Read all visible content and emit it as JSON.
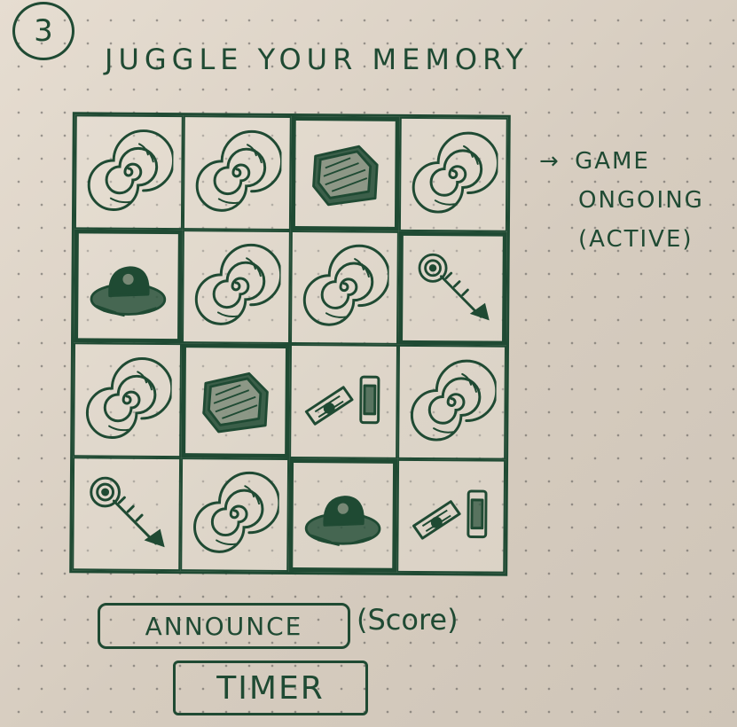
{
  "step_number": "3",
  "title": "JUGGLE YOUR MEMORY",
  "board": {
    "rows": 4,
    "columns": 4,
    "cells": [
      {
        "icon": "spiral-icon",
        "selected": false
      },
      {
        "icon": "spiral-icon",
        "selected": false
      },
      {
        "icon": "gem-icon",
        "selected": true
      },
      {
        "icon": "spiral-icon",
        "selected": false
      },
      {
        "icon": "hat-icon",
        "selected": true
      },
      {
        "icon": "spiral-icon",
        "selected": false
      },
      {
        "icon": "spiral-icon",
        "selected": false
      },
      {
        "icon": "key-icon",
        "selected": true
      },
      {
        "icon": "spiral-icon",
        "selected": false
      },
      {
        "icon": "gem-icon",
        "selected": true
      },
      {
        "icon": "scroll-icon",
        "selected": false
      },
      {
        "icon": "spiral-icon",
        "selected": false
      },
      {
        "icon": "key-icon",
        "selected": false
      },
      {
        "icon": "spiral-icon",
        "selected": false
      },
      {
        "icon": "hat-icon",
        "selected": true
      },
      {
        "icon": "scroll-icon",
        "selected": false
      }
    ]
  },
  "status_note": {
    "arrow": "→",
    "line1": "GAME",
    "line2": "ONGOING",
    "line3": "(ACTIVE)"
  },
  "announce_label": "ANNOUNCE",
  "score_note": "(Score)",
  "timer_label": "TIMER",
  "colors": {
    "ink": "#1f4a33",
    "paper": "#ddd3c6"
  }
}
